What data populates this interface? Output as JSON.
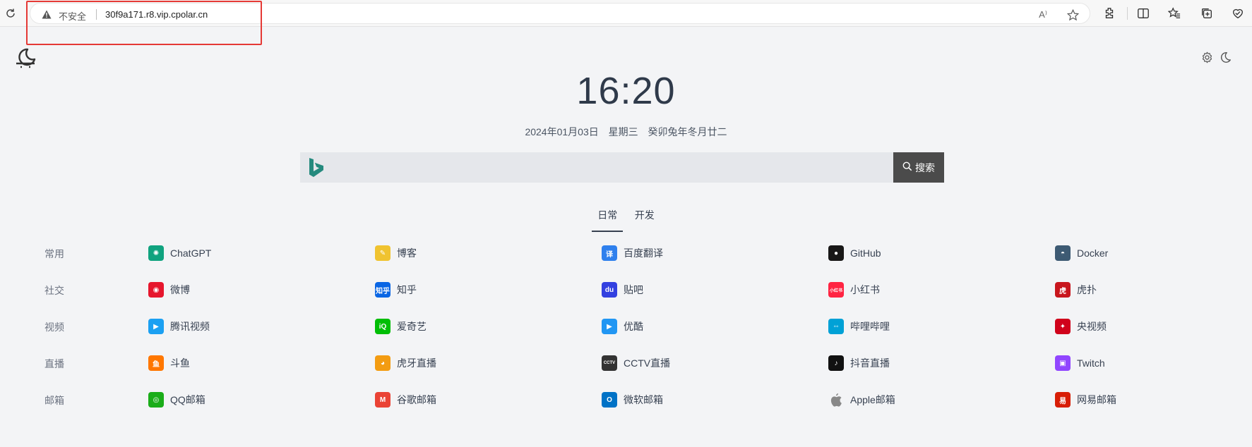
{
  "browser": {
    "insecure_label": "不安全",
    "url": "30f9a171.r8.vip.cpolar.cn",
    "read_aloud_label": "A⁾"
  },
  "clock": {
    "time": "16:20"
  },
  "date": {
    "gregorian": "2024年01月03日",
    "weekday": "星期三",
    "lunar": "癸卯兔年冬月廿二"
  },
  "search": {
    "engine_icon": "bing-icon",
    "placeholder": "",
    "button_label": "搜索"
  },
  "tabs": [
    {
      "label": "日常",
      "active": true
    },
    {
      "label": "开发",
      "active": false
    }
  ],
  "categories": [
    {
      "label": "常用",
      "links": [
        {
          "label": "ChatGPT",
          "icon": "chatgpt-icon",
          "color": "#10a37f"
        },
        {
          "label": "博客",
          "icon": "blog-icon",
          "color": "#f0c330"
        },
        {
          "label": "百度翻译",
          "icon": "baidu-translate-icon",
          "color": "#2f80ed"
        },
        {
          "label": "GitHub",
          "icon": "github-icon",
          "color": "#181717"
        },
        {
          "label": "Docker",
          "icon": "docker-icon",
          "color": "#3d5a73"
        }
      ]
    },
    {
      "label": "社交",
      "links": [
        {
          "label": "微博",
          "icon": "weibo-icon",
          "color": "#e6162d"
        },
        {
          "label": "知乎",
          "icon": "zhihu-icon",
          "color": "#0a66e4"
        },
        {
          "label": "贴吧",
          "icon": "tieba-icon",
          "color": "#3340e0"
        },
        {
          "label": "小红书",
          "icon": "xiaohongshu-icon",
          "color": "#ff2442"
        },
        {
          "label": "虎扑",
          "icon": "hupu-icon",
          "color": "#c8161d"
        }
      ]
    },
    {
      "label": "视频",
      "links": [
        {
          "label": "腾讯视频",
          "icon": "tencent-video-icon",
          "color": "#1ba0f2"
        },
        {
          "label": "爱奇艺",
          "icon": "iqiyi-icon",
          "color": "#00be06"
        },
        {
          "label": "优酷",
          "icon": "youku-icon",
          "color": "#2196f3"
        },
        {
          "label": "哔哩哔哩",
          "icon": "bilibili-icon",
          "color": "#00a1d6"
        },
        {
          "label": "央视频",
          "icon": "cctv-video-icon",
          "color": "#d0021b"
        }
      ]
    },
    {
      "label": "直播",
      "links": [
        {
          "label": "斗鱼",
          "icon": "douyu-icon",
          "color": "#ff7700"
        },
        {
          "label": "虎牙直播",
          "icon": "huya-icon",
          "color": "#f39c12"
        },
        {
          "label": "CCTV直播",
          "icon": "cctv-icon",
          "color": "#333333"
        },
        {
          "label": "抖音直播",
          "icon": "douyin-icon",
          "color": "#111111"
        },
        {
          "label": "Twitch",
          "icon": "twitch-icon",
          "color": "#9146ff"
        }
      ]
    },
    {
      "label": "邮箱",
      "links": [
        {
          "label": "QQ邮箱",
          "icon": "qq-mail-icon",
          "color": "#1aad19"
        },
        {
          "label": "谷歌邮箱",
          "icon": "gmail-icon",
          "color": "#ea4335"
        },
        {
          "label": "微软邮箱",
          "icon": "outlook-icon",
          "color": "#0072c6"
        },
        {
          "label": "Apple邮箱",
          "icon": "apple-icon",
          "color": "#888888"
        },
        {
          "label": "网易邮箱",
          "icon": "netease-mail-icon",
          "color": "#d81e06"
        }
      ]
    }
  ]
}
